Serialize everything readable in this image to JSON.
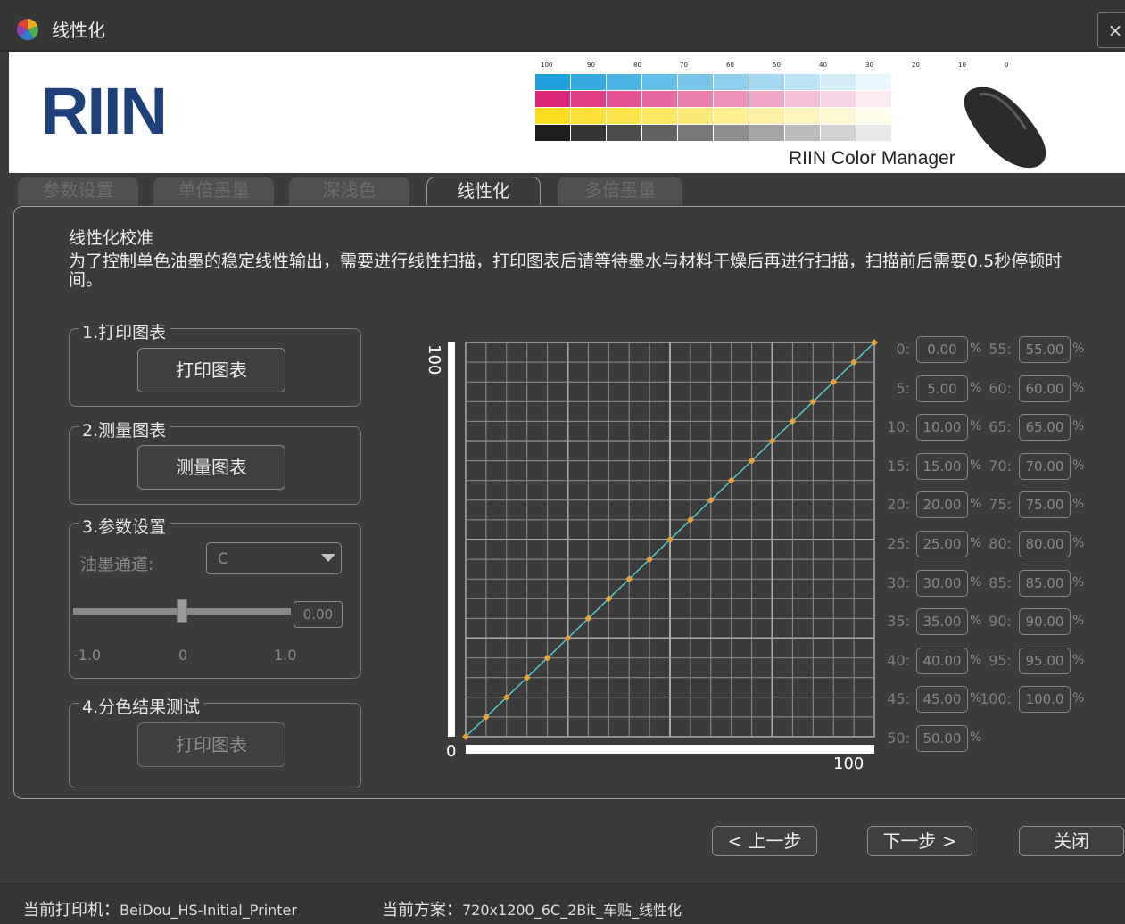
{
  "window": {
    "title": "线性化",
    "close_glyph": "×"
  },
  "banner": {
    "logo_text": "RIIN",
    "caption": "RIIN Color Manager",
    "strip_numbers": [
      "100",
      "90",
      "80",
      "70",
      "60",
      "50",
      "40",
      "30",
      "20",
      "10",
      "0"
    ]
  },
  "tabs": [
    {
      "label": "参数设置",
      "active": false
    },
    {
      "label": "单倍墨量",
      "active": false
    },
    {
      "label": "深浅色",
      "active": false
    },
    {
      "label": "线性化",
      "active": true
    },
    {
      "label": "多倍墨量",
      "active": false
    }
  ],
  "main": {
    "heading": "线性化校准",
    "description": "为了控制单色油墨的稳定线性输出，需要进行线性扫描，打印图表后请等待墨水与材料干燥后再进行扫描，扫描前后需要0.5秒停顿时间。",
    "group1": {
      "title": "1.打印图表",
      "button": "打印图表"
    },
    "group2": {
      "title": "2.测量图表",
      "button": "测量图表"
    },
    "group3": {
      "title": "3.参数设置",
      "channel_label": "油墨通道:",
      "channel_value": "C",
      "slider_value": "0.00",
      "slider_level": 0,
      "ticks": [
        "-1.0",
        "0",
        "1.0"
      ]
    },
    "group4": {
      "title": "4.分色结果测试",
      "button": "打印图表"
    }
  },
  "chart_data": {
    "type": "line",
    "x_tick_labels": [
      "0",
      "100"
    ],
    "y_tick_labels": [
      "100"
    ],
    "xlim": [
      0,
      100
    ],
    "ylim": [
      0,
      100
    ],
    "grid": true,
    "series": [
      {
        "x": [
          0,
          5,
          10,
          15,
          20,
          25,
          30,
          35,
          40,
          45,
          50,
          55,
          60,
          65,
          70,
          75,
          80,
          85,
          90,
          95,
          100
        ],
        "y": [
          0,
          5,
          10,
          15,
          20,
          25,
          30,
          35,
          40,
          45,
          50,
          55,
          60,
          65,
          70,
          75,
          80,
          85,
          90,
          95,
          100
        ]
      }
    ],
    "colors": {
      "line": "#58c8c8",
      "points": "#e8a23a",
      "grid": "#8f8f8f"
    }
  },
  "values": [
    {
      "label": "0:",
      "value": "0.00"
    },
    {
      "label": "5:",
      "value": "5.00"
    },
    {
      "label": "10:",
      "value": "10.00"
    },
    {
      "label": "15:",
      "value": "15.00"
    },
    {
      "label": "20:",
      "value": "20.00"
    },
    {
      "label": "25:",
      "value": "25.00"
    },
    {
      "label": "30:",
      "value": "30.00"
    },
    {
      "label": "35:",
      "value": "35.00"
    },
    {
      "label": "40:",
      "value": "40.00"
    },
    {
      "label": "45:",
      "value": "45.00"
    },
    {
      "label": "50:",
      "value": "50.00"
    },
    {
      "label": "55:",
      "value": "55.00"
    },
    {
      "label": "60:",
      "value": "60.00"
    },
    {
      "label": "65:",
      "value": "65.00"
    },
    {
      "label": "70:",
      "value": "70.00"
    },
    {
      "label": "75:",
      "value": "75.00"
    },
    {
      "label": "80:",
      "value": "80.00"
    },
    {
      "label": "85:",
      "value": "85.00"
    },
    {
      "label": "90:",
      "value": "90.00"
    },
    {
      "label": "95:",
      "value": "95.00"
    },
    {
      "label": "100:",
      "value": "100.0"
    }
  ],
  "percent_sign": "%",
  "footer": {
    "prev": "< 上一步",
    "next": "下一步 >",
    "close": "关闭"
  },
  "status": {
    "printer_label": "当前打印机：",
    "printer": "BeiDou_HS-Initial_Printer",
    "scheme_label": "当前方案：",
    "scheme": "720x1200_6C_2Bit_车贴_线性化"
  }
}
